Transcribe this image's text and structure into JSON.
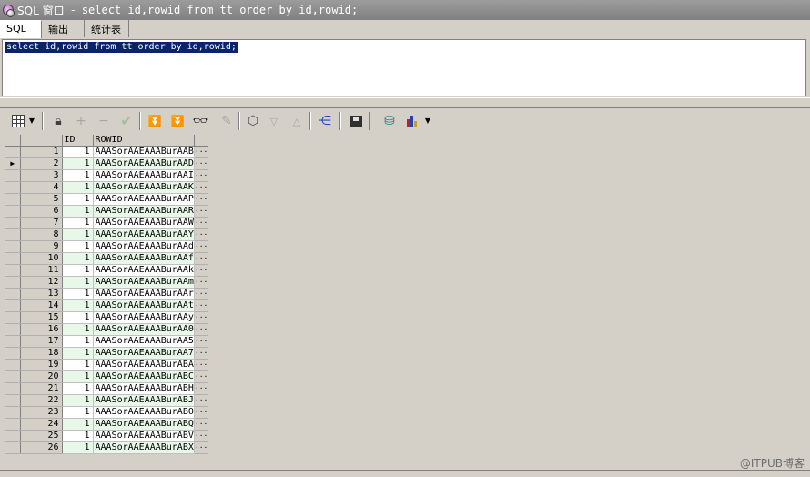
{
  "window": {
    "title_app": "SQL 窗口",
    "title_sep": "-",
    "title_query": "select id,rowid from tt order by id,rowid;"
  },
  "tabs": [
    {
      "label": "SQL",
      "active": true
    },
    {
      "label": "输出",
      "active": false
    },
    {
      "label": "统计表",
      "active": false
    }
  ],
  "editor": {
    "sql": "select id,rowid from tt order by id,rowid;"
  },
  "toolbar": {
    "icons": [
      "grid-select-icon",
      "lock-icon",
      "add-row-icon",
      "delete-row-icon",
      "post-check-icon",
      "fetch-next-icon",
      "fetch-last-icon",
      "find-icon",
      "clear-icon",
      "export-icon",
      "sort-down-icon",
      "sort-up-icon",
      "query-plan-icon",
      "save-icon",
      "db-icon",
      "chart-icon"
    ]
  },
  "grid": {
    "columns": [
      "ID",
      "ROWID"
    ],
    "more_label": "···",
    "current_row_marker": "▶",
    "current_row": 2,
    "rows": [
      {
        "n": "1",
        "id": "1",
        "rowid": "AAASorAAEAAABurAAB"
      },
      {
        "n": "2",
        "id": "1",
        "rowid": "AAASorAAEAAABurAAD"
      },
      {
        "n": "3",
        "id": "1",
        "rowid": "AAASorAAEAAABurAAI"
      },
      {
        "n": "4",
        "id": "1",
        "rowid": "AAASorAAEAAABurAAK"
      },
      {
        "n": "5",
        "id": "1",
        "rowid": "AAASorAAEAAABurAAP"
      },
      {
        "n": "6",
        "id": "1",
        "rowid": "AAASorAAEAAABurAAR"
      },
      {
        "n": "7",
        "id": "1",
        "rowid": "AAASorAAEAAABurAAW"
      },
      {
        "n": "8",
        "id": "1",
        "rowid": "AAASorAAEAAABurAAY"
      },
      {
        "n": "9",
        "id": "1",
        "rowid": "AAASorAAEAAABurAAd"
      },
      {
        "n": "10",
        "id": "1",
        "rowid": "AAASorAAEAAABurAAf"
      },
      {
        "n": "11",
        "id": "1",
        "rowid": "AAASorAAEAAABurAAk"
      },
      {
        "n": "12",
        "id": "1",
        "rowid": "AAASorAAEAAABurAAm"
      },
      {
        "n": "13",
        "id": "1",
        "rowid": "AAASorAAEAAABurAAr"
      },
      {
        "n": "14",
        "id": "1",
        "rowid": "AAASorAAEAAABurAAt"
      },
      {
        "n": "15",
        "id": "1",
        "rowid": "AAASorAAEAAABurAAy"
      },
      {
        "n": "16",
        "id": "1",
        "rowid": "AAASorAAEAAABurAA0"
      },
      {
        "n": "17",
        "id": "1",
        "rowid": "AAASorAAEAAABurAA5"
      },
      {
        "n": "18",
        "id": "1",
        "rowid": "AAASorAAEAAABurAA7"
      },
      {
        "n": "19",
        "id": "1",
        "rowid": "AAASorAAEAAABurABA"
      },
      {
        "n": "20",
        "id": "1",
        "rowid": "AAASorAAEAAABurABC"
      },
      {
        "n": "21",
        "id": "1",
        "rowid": "AAASorAAEAAABurABH"
      },
      {
        "n": "22",
        "id": "1",
        "rowid": "AAASorAAEAAABurABJ"
      },
      {
        "n": "23",
        "id": "1",
        "rowid": "AAASorAAEAAABurABO"
      },
      {
        "n": "24",
        "id": "1",
        "rowid": "AAASorAAEAAABurABQ"
      },
      {
        "n": "25",
        "id": "1",
        "rowid": "AAASorAAEAAABurABV"
      },
      {
        "n": "26",
        "id": "1",
        "rowid": "AAASorAAEAAABurABX"
      }
    ]
  },
  "watermark": "@ITPUB博客"
}
